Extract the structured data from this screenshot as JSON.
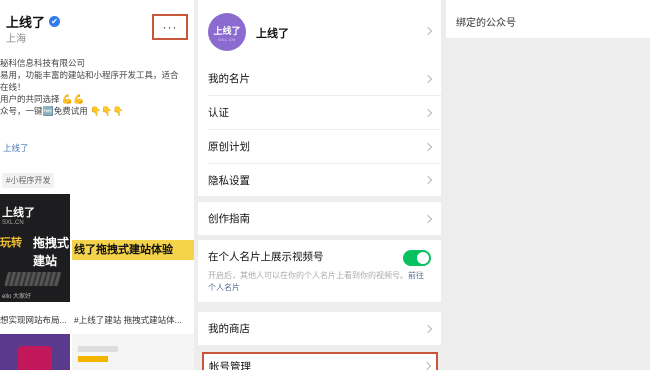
{
  "profile": {
    "name": "上线了",
    "verified_mark": "✔",
    "location": "上海",
    "more_label": "···",
    "bio_lines": [
      "秘科信息科技有限公司",
      "易用，功能丰富的建站和小程序开发工具，适合",
      "在线！",
      "用户的共同选择",
      "众号，一键",
      "上线了"
    ],
    "bio_badge_text": "免费试用",
    "tag": "#小程序开发",
    "thumbnails": [
      {
        "line1": "上线了",
        "line1_sub": "SXL.CN",
        "line2": "玩转",
        "line3": "拖拽式",
        "line4": "建站",
        "line5": "ello 大家好",
        "caption": "想实现网站布局..."
      },
      {
        "banner": "线了拖拽式建站体验",
        "caption": "#上线了建站 拖拽式建站体..."
      }
    ]
  },
  "settings": {
    "account_name": "上线了",
    "avatar_text": "上线了",
    "avatar_sub": "SXL.CN",
    "items": [
      {
        "label": "我的名片"
      },
      {
        "label": "认证"
      },
      {
        "label": "原创计划"
      },
      {
        "label": "隐私设置"
      },
      {
        "label": "创作指南"
      }
    ],
    "channel_toggle_label": "在个人名片上展示视频号",
    "channel_toggle_on": true,
    "channel_hint": "开启后，其他人可以在你的个人名片上看到你的视频号。",
    "channel_hint_link": "前往个人名片",
    "shop_label": "我的商店",
    "account_mgmt_label": "帐号管理"
  },
  "bound_panel": {
    "title": "绑定的公众号"
  },
  "colors": {
    "highlight_border": "#c8563a",
    "toggle_on": "#07c160",
    "avatar_bg": "#8c6bd0",
    "link": "#576b95"
  }
}
